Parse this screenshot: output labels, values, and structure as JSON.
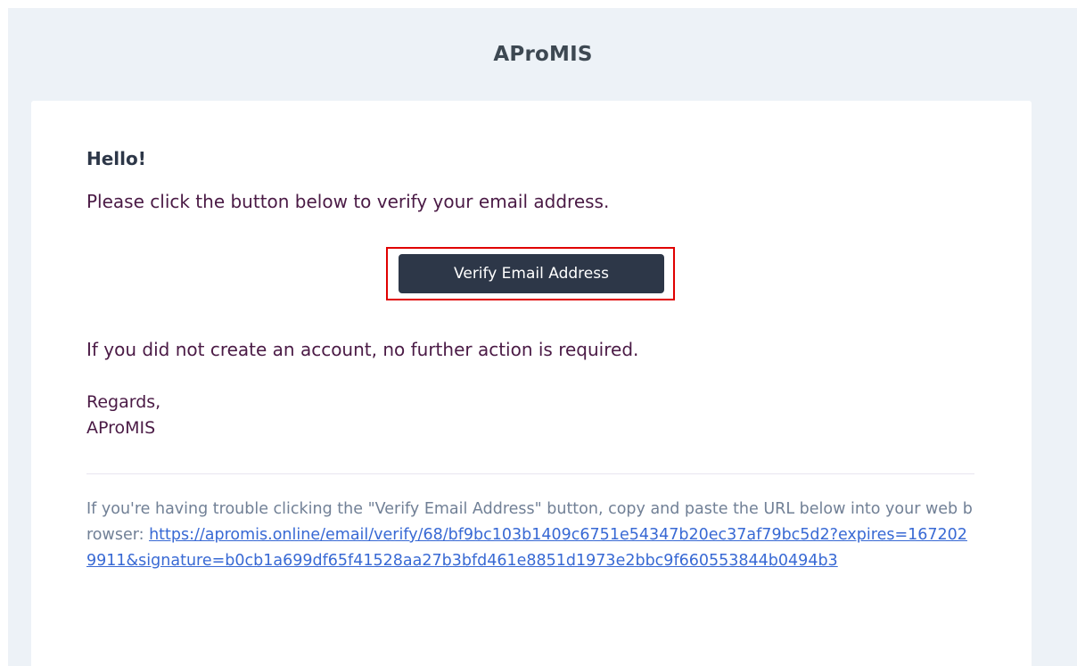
{
  "header": {
    "brand": "AProMIS"
  },
  "body": {
    "greeting": "Hello!",
    "intro": "Please click the button below to verify your email address.",
    "button_label": "Verify Email Address",
    "outro": "If you did not create an account, no further action is required.",
    "salutation_line1": "Regards,",
    "salutation_line2": "AProMIS"
  },
  "subcopy": {
    "text": "If you're having trouble clicking the \"Verify Email Address\" button, copy and paste the URL below into your web browser: ",
    "link": "https://apromis.online/email/verify/68/bf9bc103b1409c6751e54347b20ec37af79bc5d2?expires=1672029911&signature=b0cb1a699df65f41528aa27b3bfd461e8851d1973e2bbc9f660553844b0494b3"
  },
  "colors": {
    "background": "#edf2f7",
    "button": "#2d3748",
    "highlight_border": "#e00000",
    "link": "#3869d4"
  }
}
